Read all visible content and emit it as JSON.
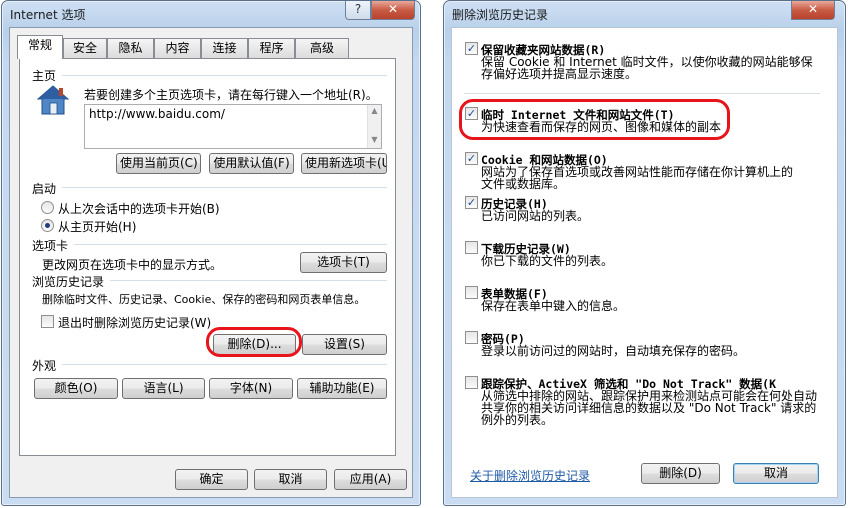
{
  "left_dialog": {
    "title": "Internet 选项",
    "help_btn": "?",
    "close_btn": "✕",
    "tabs": [
      "常规",
      "安全",
      "隐私",
      "内容",
      "连接",
      "程序",
      "高级"
    ],
    "homepage": {
      "heading": "主页",
      "description": "若要创建多个主页选项卡，请在每行键入一个地址(R)。",
      "url": "http://www.baidu.com/",
      "btn_current": "使用当前页(C)",
      "btn_default": "使用默认值(F)",
      "btn_newtab": "使用新选项卡(U)"
    },
    "startup": {
      "heading": "启动",
      "option_last_session": "从上次会话中的选项卡开始(B)",
      "option_homepage": "从主页开始(H)",
      "selected": "option_homepage"
    },
    "tabs_section": {
      "heading": "选项卡",
      "description": "更改网页在选项卡中的显示方式。",
      "btn": "选项卡(T)"
    },
    "history": {
      "heading": "浏览历史记录",
      "description": "删除临时文件、历史记录、Cookie、保存的密码和网页表单信息。",
      "checkbox_label": "退出时删除浏览历史记录(W)",
      "checkbox_checked": false,
      "btn_delete": "删除(D)...",
      "btn_settings": "设置(S)"
    },
    "appearance": {
      "heading": "外观",
      "btn_colors": "颜色(O)",
      "btn_languages": "语言(L)",
      "btn_fonts": "字体(N)",
      "btn_accessibility": "辅助功能(E)"
    },
    "footer": {
      "ok": "确定",
      "cancel": "取消",
      "apply": "应用(A)"
    }
  },
  "right_dialog": {
    "title": "删除浏览历史记录",
    "close_btn": "✕",
    "items": [
      {
        "checked": true,
        "title": "保留收藏夹网站数据(R)",
        "desc": [
          "保留 Cookie 和 Internet 临时文件，以使你收藏的网站能够保",
          "存偏好选项并提高显示速度。"
        ]
      },
      {
        "checked": true,
        "title": "临时 Internet 文件和网站文件(T)",
        "desc": [
          "为快速查看而保存的网页、图像和媒体的副本"
        ]
      },
      {
        "checked": true,
        "title": "Cookie 和网站数据(O)",
        "desc": [
          "网站为了保存首选项或改善网站性能而存储在你计算机上的",
          "文件或数据库。"
        ]
      },
      {
        "checked": true,
        "title": "历史记录(H)",
        "desc": [
          "已访问网站的列表。"
        ]
      },
      {
        "checked": false,
        "title": "下载历史记录(W)",
        "desc": [
          "你已下载的文件的列表。"
        ]
      },
      {
        "checked": false,
        "title": "表单数据(F)",
        "desc": [
          "保存在表单中键入的信息。"
        ]
      },
      {
        "checked": false,
        "title": "密码(P)",
        "desc": [
          "登录以前访问过的网站时，自动填充保存的密码。"
        ]
      },
      {
        "checked": false,
        "title": "跟踪保护、ActiveX 筛选和 \"Do Not Track\" 数据(K",
        "desc": [
          "从筛选中排除的网站、跟踪保护用来检测站点可能会在何处自动",
          "共享你的相关访问详细信息的数据以及 \"Do Not Track\" 请求的",
          "例外的列表。"
        ]
      }
    ],
    "footer": {
      "link": "关于删除浏览历史记录",
      "delete": "删除(D)",
      "cancel": "取消"
    }
  },
  "colors": {
    "highlight": "#e8141b",
    "link": "#1f5aa6"
  }
}
